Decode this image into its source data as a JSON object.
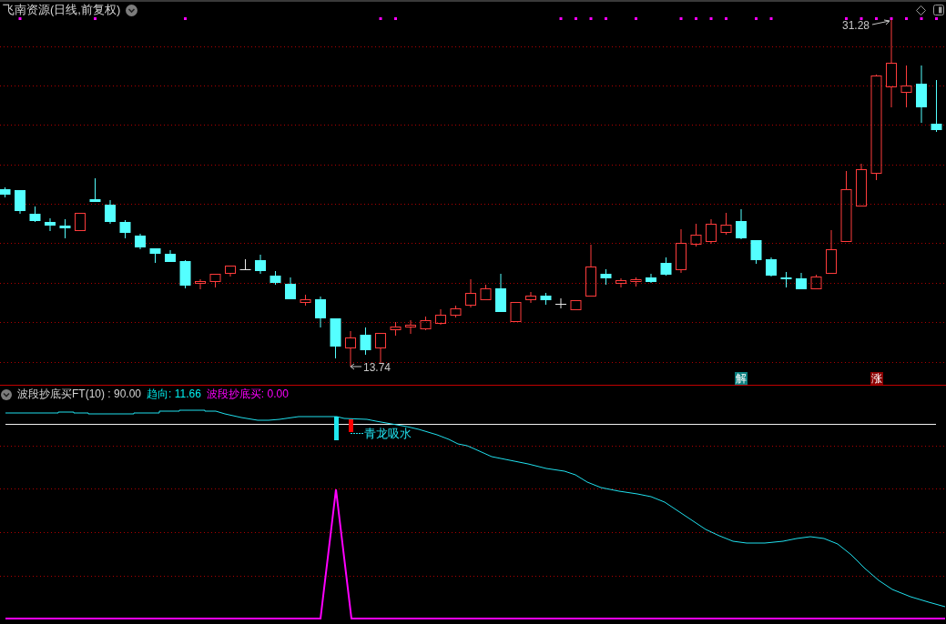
{
  "header": {
    "title": "飞南资源(日线,前复权)"
  },
  "price_chart": {
    "high_label": "31.28",
    "low_label": "13.74",
    "markers": [
      {
        "text": "解",
        "color": "#0a7f7f"
      },
      {
        "text": "涨",
        "color": "#8a0000"
      }
    ]
  },
  "indicator_panel": {
    "title": "波段抄底买FT(10) : 90.00",
    "readouts": [
      {
        "text": "趋向: 11.66",
        "color": "#00f0f0"
      },
      {
        "text": "波段抄底买: 0.00",
        "color": "#ff00ff"
      }
    ],
    "annotation": "青龙吸水"
  }
}
